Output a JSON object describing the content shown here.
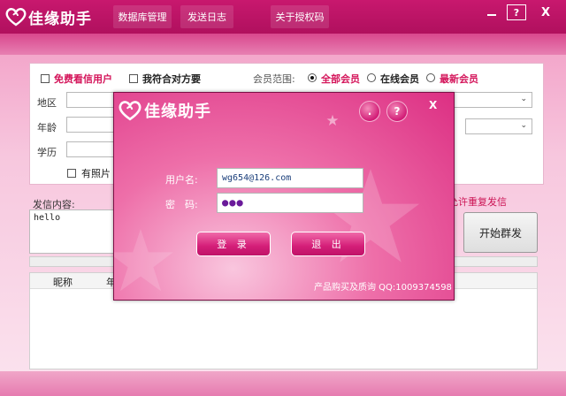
{
  "app": {
    "logo_text": "佳缘助手",
    "menu": [
      "数据库管理",
      "发送日志",
      "关于授权码"
    ],
    "help_label": "?",
    "close_label": "X"
  },
  "filters": {
    "free_users": "免费看信用户",
    "match_me": "我符合对方要",
    "member_scope_label": "会员范围:",
    "scope_all": "全部会员",
    "scope_online": "在线会员",
    "scope_new": "最新会员",
    "region": "地区",
    "age": "年龄",
    "education": "学历",
    "has_photo": "有照片"
  },
  "send": {
    "content_label": "发信内容:",
    "message": "hello",
    "allow_repeat": "允许重复发信",
    "start_button": "开始群发"
  },
  "list": {
    "columns": [
      "昵称",
      "年"
    ]
  },
  "login": {
    "logo_text": "佳缘助手",
    "minimize": ".",
    "help": "?",
    "close": "X",
    "username_label": "用户名:",
    "username_value": "wg654@126.com",
    "password_label": "密　码:",
    "password_value": "●●●",
    "login_button": "登 录",
    "exit_button": "退 出",
    "footer": "产品购买及质询 QQ:1009374598"
  }
}
